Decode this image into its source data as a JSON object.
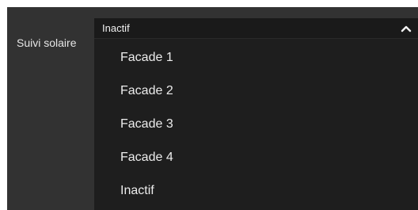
{
  "field": {
    "label": "Suivi solaire"
  },
  "select": {
    "value": "Inactif",
    "expanded_icon": "chevron-up-icon"
  },
  "options": [
    "Facade 1",
    "Facade 2",
    "Facade 3",
    "Facade 4",
    "Inactif"
  ],
  "colors": {
    "panel_bg": "#323232",
    "select_bg": "#1a1a1a",
    "dropdown_bg": "#1e1e1e",
    "text": "#ececec"
  }
}
